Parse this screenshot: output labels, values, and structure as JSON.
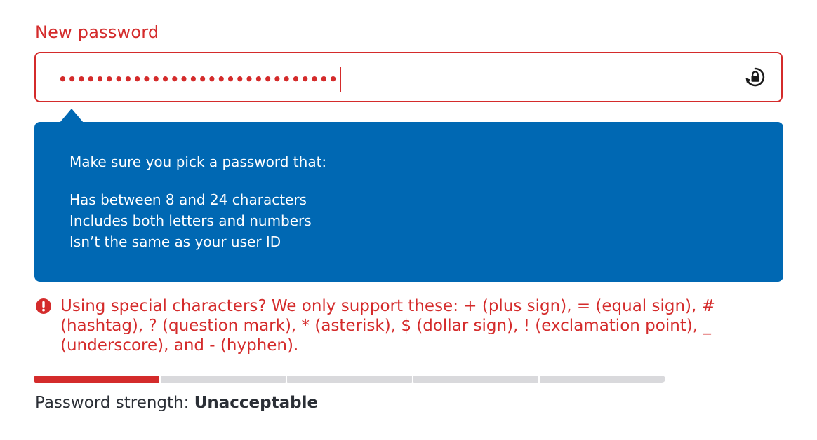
{
  "field": {
    "label": "New password",
    "masked_value": "••••••••••••••••••••••••••••••",
    "toggle_icon": "lock-rotate-icon"
  },
  "tooltip": {
    "intro": "Make sure you pick a password that:",
    "requirements": [
      "Has between 8 and 24 characters",
      "Includes both letters and numbers",
      "Isn’t the same as your user ID"
    ]
  },
  "warning": {
    "icon": "exclamation-circle-icon",
    "text": "Using special characters? We only support these: + (plus sign), = (equal sign), # (hashtag), ? (question mark), * (asterisk), $ (dollar sign), ! (exclamation point), _ (underscore), and - (hyphen)."
  },
  "strength": {
    "label": "Password strength:",
    "value": "Unacceptable",
    "segments_total": 5,
    "segments_filled": 1
  },
  "colors": {
    "error": "#d42b2b",
    "tooltip_bg": "#0068b3",
    "bar_empty": "#d9d9dc",
    "text": "#2b2f36"
  }
}
